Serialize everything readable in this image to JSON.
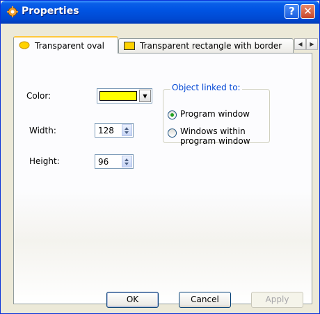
{
  "window": {
    "title": "Properties"
  },
  "titlebar": {
    "help_glyph": "?",
    "close_glyph": "✕"
  },
  "tabs": [
    {
      "label": "Transparent oval",
      "active": true,
      "icon": "yellow-oval-icon"
    },
    {
      "label": "Transparent rectangle with border",
      "active": false,
      "icon": "yellow-rectangle-icon"
    }
  ],
  "tab_scroll": {
    "left": "◀",
    "right": "▶"
  },
  "form": {
    "color_label": "Color:",
    "color_value": "#ffff00",
    "width_label": "Width:",
    "width_value": "128",
    "height_label": "Height:",
    "height_value": "96"
  },
  "linked": {
    "title": "Object linked to:",
    "options": [
      {
        "label": "Program window",
        "checked": true
      },
      {
        "label_line1": "Windows within",
        "label_line2": "program window",
        "checked": false
      }
    ]
  },
  "buttons": {
    "ok": "OK",
    "cancel": "Cancel",
    "apply": "Apply"
  }
}
